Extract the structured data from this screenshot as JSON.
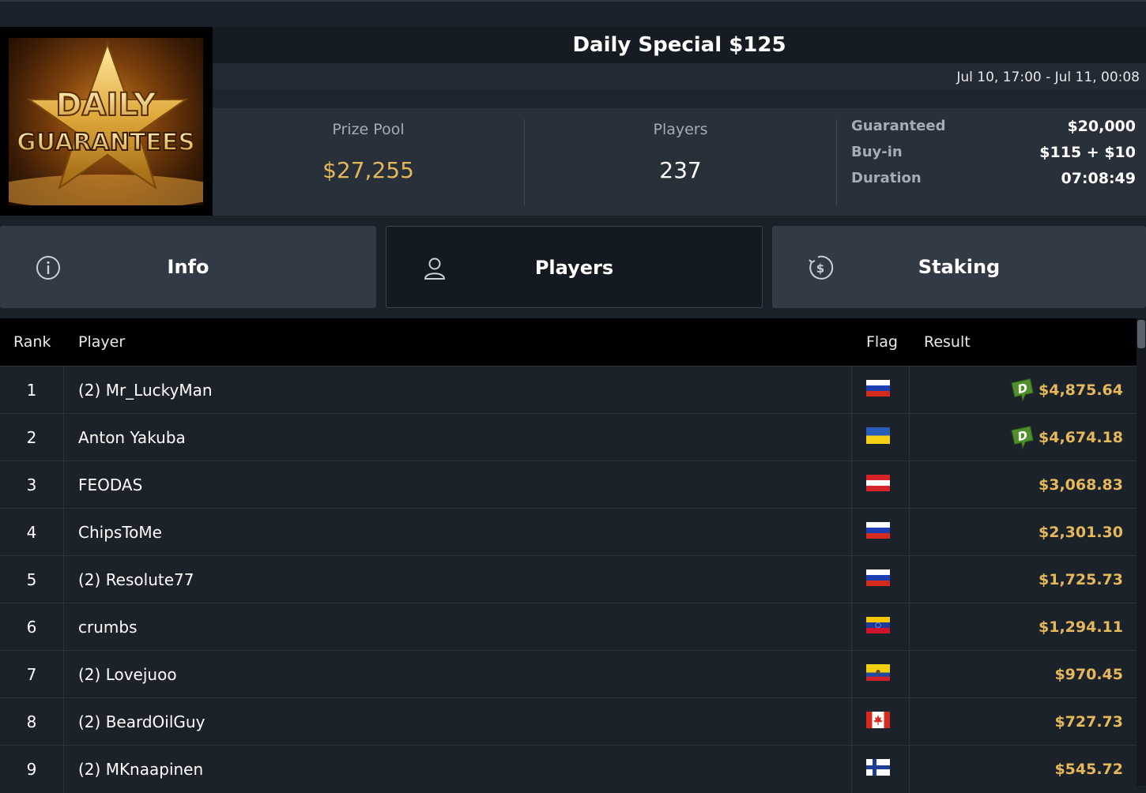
{
  "header": {
    "logo": {
      "line1": "DAILY",
      "line2": "GUARANTEES"
    },
    "title": "Daily Special $125",
    "date_range": "Jul 10, 17:00 - Jul 11, 00:08"
  },
  "stats": {
    "prize_pool_label": "Prize Pool",
    "prize_pool_value": "$27,255",
    "players_label": "Players",
    "players_value": "237",
    "details": [
      {
        "key": "Guaranteed",
        "value": "$20,000"
      },
      {
        "key": "Buy-in",
        "value": "$115 + $10"
      },
      {
        "key": "Duration",
        "value": "07:08:49"
      }
    ]
  },
  "tabs": [
    {
      "label": "Info",
      "icon": "info-icon"
    },
    {
      "label": "Players",
      "icon": "user-icon",
      "active": true
    },
    {
      "label": "Staking",
      "icon": "dollar-coin-icon"
    }
  ],
  "table": {
    "headers": {
      "rank": "Rank",
      "player": "Player",
      "flag": "Flag",
      "result": "Result"
    },
    "rows": [
      {
        "rank": "1",
        "player": "(2) Mr_LuckyMan",
        "flag": "russia",
        "result": "$4,875.64",
        "badge": "D"
      },
      {
        "rank": "2",
        "player": "Anton Yakuba",
        "flag": "ukraine",
        "result": "$4,674.18",
        "badge": "D"
      },
      {
        "rank": "3",
        "player": "FEODAS",
        "flag": "austria",
        "result": "$3,068.83"
      },
      {
        "rank": "4",
        "player": "ChipsToMe",
        "flag": "russia",
        "result": "$2,301.30"
      },
      {
        "rank": "5",
        "player": "(2) Resolute77",
        "flag": "russia",
        "result": "$1,725.73"
      },
      {
        "rank": "6",
        "player": "crumbs",
        "flag": "venezuela",
        "result": "$1,294.11"
      },
      {
        "rank": "7",
        "player": "(2) Lovejuoo",
        "flag": "ecuador",
        "result": "$970.45"
      },
      {
        "rank": "8",
        "player": "(2) BeardOilGuy",
        "flag": "canada",
        "result": "$727.73"
      },
      {
        "rank": "9",
        "player": "(2) MKnaapinen",
        "flag": "finland",
        "result": "$545.72"
      }
    ]
  },
  "colors": {
    "accent_gold": "#e5b85a",
    "badge_green": "#4a8a2a"
  }
}
